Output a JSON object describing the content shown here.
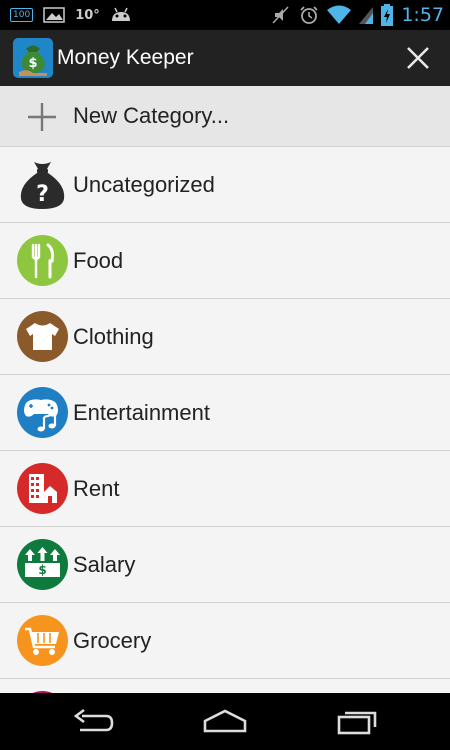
{
  "status_bar": {
    "battery_notification": "100",
    "temperature": "10°",
    "time": "1:57",
    "accent_color": "#4fb4e8"
  },
  "action_bar": {
    "title": "Money Keeper",
    "close_icon": "close-icon"
  },
  "list": {
    "new_category_label": "New Category...",
    "categories": [
      {
        "label": "Uncategorized",
        "icon": "money-bag-question-icon",
        "color": "#2b2b2b"
      },
      {
        "label": "Food",
        "icon": "fork-knife-icon",
        "color": "#8dc63f"
      },
      {
        "label": "Clothing",
        "icon": "tshirt-icon",
        "color": "#8a5a2b"
      },
      {
        "label": "Entertainment",
        "icon": "gamepad-music-icon",
        "color": "#1f7fc4"
      },
      {
        "label": "Rent",
        "icon": "building-icon",
        "color": "#d62a2a"
      },
      {
        "label": "Salary",
        "icon": "money-arrows-icon",
        "color": "#0f7a3d"
      },
      {
        "label": "Grocery",
        "icon": "shopping-cart-icon",
        "color": "#f7941d"
      }
    ],
    "partial_item_color": "#b0126b"
  },
  "nav_bar": {
    "back_icon": "back-icon",
    "home_icon": "home-icon",
    "recents_icon": "recent-apps-icon"
  }
}
